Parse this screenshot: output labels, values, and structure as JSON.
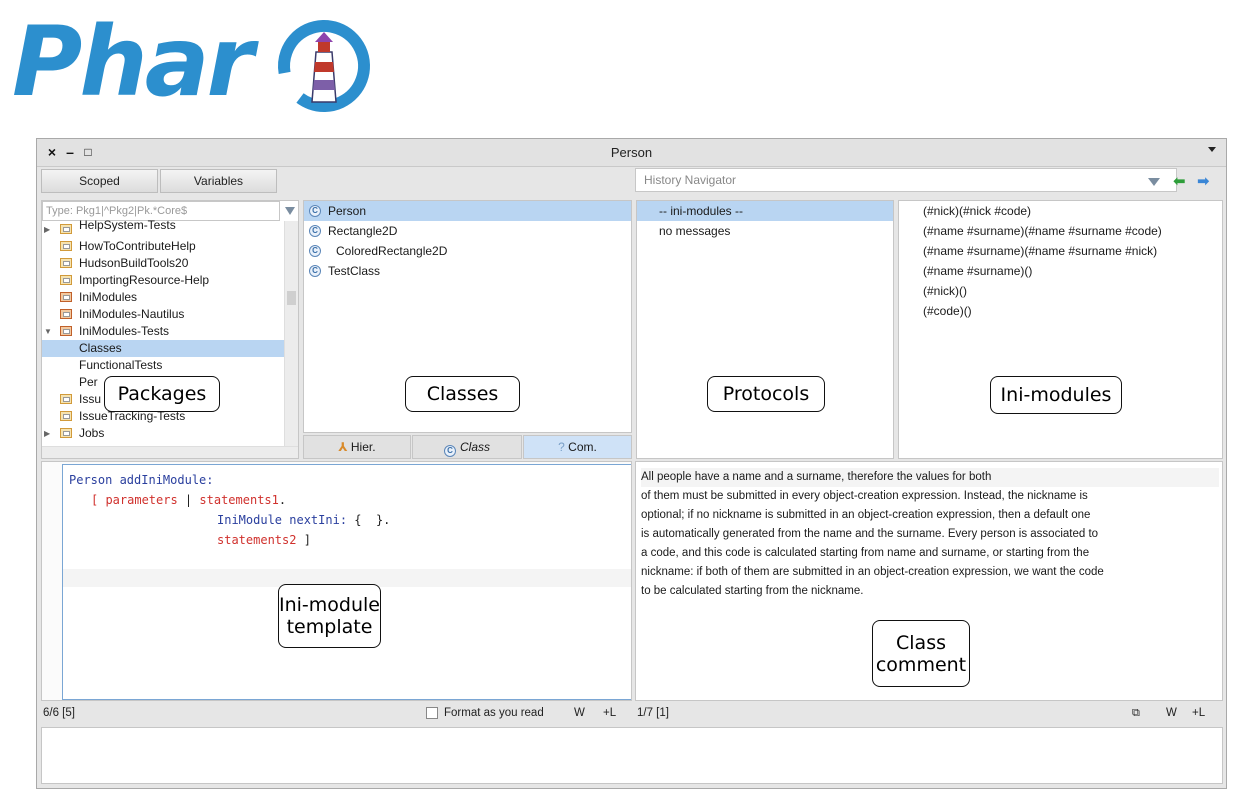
{
  "logo": {
    "text": "Phar"
  },
  "window": {
    "title": "Person",
    "close_glyph": "×",
    "minimize_glyph": "–",
    "maximize_glyph": "□",
    "menu_icon": "chevron-down-icon"
  },
  "toolbar": {
    "scoped_label": "Scoped",
    "variables_label": "Variables",
    "history_placeholder": "History Navigator",
    "back_glyph": "⬅",
    "forward_glyph": "➡"
  },
  "packages": {
    "filter_placeholder": "Type: Pkg1|^Pkg2|Pk.*Core$",
    "items": [
      {
        "label": "HelpSystem-Tests",
        "expandable": true,
        "icon": "package"
      },
      {
        "label": "HowToContributeHelp",
        "icon": "package"
      },
      {
        "label": "HudsonBuildTools20",
        "icon": "package"
      },
      {
        "label": "ImportingResource-Help",
        "icon": "package"
      },
      {
        "label": "IniModules",
        "icon": "package-red"
      },
      {
        "label": "IniModules-Nautilus",
        "icon": "package-red"
      },
      {
        "label": "IniModules-Tests",
        "expanded": true,
        "icon": "package-red"
      },
      {
        "label": "Classes",
        "selected": true,
        "child": true
      },
      {
        "label": "FunctionalTests",
        "child": true
      },
      {
        "label": "Per",
        "child": true
      },
      {
        "label": "Issu",
        "icon": "package"
      },
      {
        "label": "IssueTracking-Tests",
        "icon": "package"
      },
      {
        "label": "Jobs",
        "expandable": true,
        "icon": "package"
      }
    ]
  },
  "classes": {
    "items": [
      {
        "label": "Person",
        "selected": true
      },
      {
        "label": "Rectangle2D"
      },
      {
        "label": "ColoredRectangle2D",
        "indent": true
      },
      {
        "label": "TestClass"
      }
    ],
    "tabs": {
      "hier": "Hier.",
      "class": "Class",
      "com": "Com."
    }
  },
  "protocols": {
    "items": [
      {
        "label": "-- ini-modules --",
        "selected": true
      },
      {
        "label": "no messages"
      }
    ]
  },
  "methods": {
    "items": [
      "(#nick)(#nick #code)",
      "(#name #surname)(#name #surname #code)",
      "(#name #surname)(#name #surname #nick)",
      "(#name #surname)()",
      "(#nick)()",
      "(#code)()"
    ]
  },
  "code": {
    "line1_a": "Person addIniModule:",
    "line2_a": "[ ",
    "line2_b": "parameters",
    "line2_c": " | ",
    "line2_d": "statements1",
    "line2_e": ".",
    "line3_a": "IniModule nextIni:",
    "line3_b": " {  }.",
    "line4_a": "statements2",
    "line4_b": " ]"
  },
  "comment": {
    "lines": [
      "All people have a name and a surname, therefore the values for both",
      "of them must be submitted in every object-creation expression. Instead, the nickname is",
      "optional; if no nickname is submitted in an object-creation expression, then a default one",
      "is automatically generated from the name and the surname. Every person is associated to",
      "a code, and this code is calculated starting from name and surname, or starting from the",
      "nickname: if both of them are submitted in an object-creation expression, we want the code",
      "to be calculated starting from the nickname."
    ]
  },
  "code_status": {
    "position": "6/6 [5]",
    "format_label": "Format as you read",
    "w_label": "W",
    "l_label": "+L"
  },
  "comment_status": {
    "position": "1/7 [1]",
    "w_label": "W",
    "l_label": "+L"
  },
  "callouts": {
    "packages": "Packages",
    "classes": "Classes",
    "protocols": "Protocols",
    "ini_modules": "Ini-modules",
    "template_1": "Ini-module",
    "template_2": "template",
    "comment_1": "Class",
    "comment_2": "comment"
  }
}
